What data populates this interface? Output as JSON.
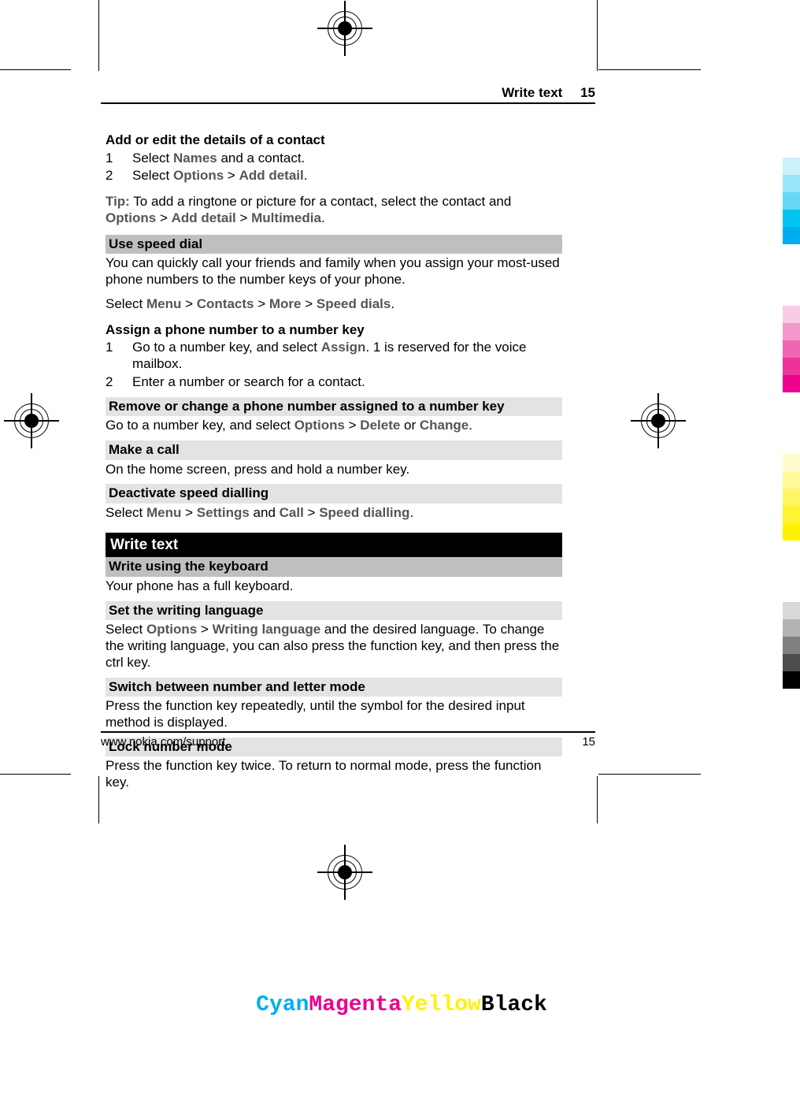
{
  "header": {
    "title": "Write text",
    "page": "15"
  },
  "footer": {
    "url": "www.nokia.com/support",
    "page": "15"
  },
  "cmyk": {
    "c": "Cyan",
    "m": "Magenta",
    "y": "Yellow",
    "k": "Black"
  },
  "s1": {
    "title": "Add or edit the details of a contact",
    "step1_pre": "Select ",
    "step1_b1": "Names",
    "step1_post": " and a contact.",
    "step2_pre": "Select ",
    "step2_b1": "Options",
    "step2_gt": " > ",
    "step2_b2": "Add detail",
    "step2_post": "."
  },
  "tip": {
    "label": "Tip:",
    "t1": " To add a ringtone or picture for a contact, select the contact and ",
    "b1": "Options",
    "gt1": " > ",
    "b2": "Add detail",
    "gt2": " > ",
    "b3": "Multimedia",
    "post": "."
  },
  "speed": {
    "h": "Use speed dial",
    "p1": "You can quickly call your friends and family when you assign your most-used phone numbers to the number keys of your phone.",
    "nav_pre": "Select ",
    "n1": "Menu",
    "gt": " > ",
    "n2": "Contacts",
    "n3": "More",
    "n4": "Speed dials",
    "post": "."
  },
  "assign": {
    "h": "Assign a phone number to a number key",
    "s1_pre": "Go to a number key, and select ",
    "s1_b": "Assign",
    "s1_post": ". 1 is reserved for the voice mailbox.",
    "s2": "Enter a number or search for a contact."
  },
  "remove": {
    "h": "Remove or change a phone number assigned to a number key",
    "pre": "Go to a number key, and select ",
    "b1": "Options",
    "gt": " > ",
    "b2": "Delete",
    "or": " or ",
    "b3": "Change",
    "post": "."
  },
  "make": {
    "h": "Make a call",
    "p": "On the home screen, press and hold a number key."
  },
  "deact": {
    "h": "Deactivate speed dialling",
    "pre": "Select ",
    "b1": "Menu",
    "gt": " > ",
    "b2": "Settings",
    "and": " and ",
    "b3": "Call",
    "b4": "Speed dialling",
    "post": "."
  },
  "wt": {
    "h": "Write text"
  },
  "wk": {
    "h": "Write using the keyboard",
    "p": "Your phone has a full keyboard."
  },
  "lang": {
    "h": "Set the writing language",
    "pre": "Select ",
    "b1": "Options",
    "gt": " > ",
    "b2": "Writing language",
    "post": " and the desired language. To change the writing language, you can also press the function key, and then press the ctrl key."
  },
  "switch": {
    "h": "Switch between number and letter mode",
    "p": "Press the function key repeatedly, until the symbol for the desired input method is displayed."
  },
  "lock": {
    "h": "Lock number mode",
    "p": "Press the function key twice. To return to normal mode, press the function key."
  }
}
